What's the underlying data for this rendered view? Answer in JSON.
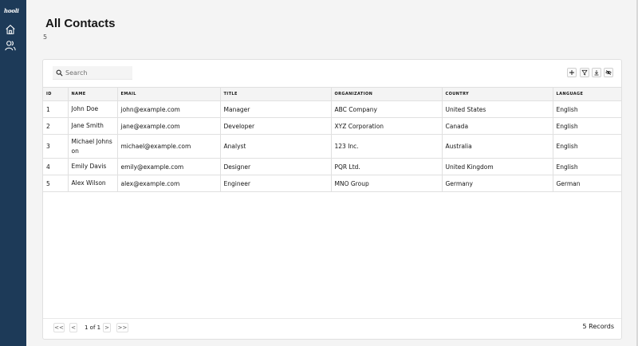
{
  "brand": {
    "logo_text": "hooli",
    "sidebar_color": "#1d3a58"
  },
  "sidebar": {
    "items": [
      {
        "icon": "home-icon"
      },
      {
        "icon": "users-icon"
      }
    ]
  },
  "page": {
    "title": "All Contacts",
    "count": "5"
  },
  "search": {
    "placeholder": "Search",
    "value": ""
  },
  "toolbar": {
    "icons": [
      "add-icon",
      "filter-icon",
      "download-icon",
      "hide-columns-icon"
    ]
  },
  "table": {
    "columns": [
      "ID",
      "NAME",
      "EMAIL",
      "TITLE",
      "ORGANIZATION",
      "COUNTRY",
      "LANGUAGE"
    ],
    "rows": [
      {
        "id": "1",
        "name": "John Doe",
        "email": "john@example.com",
        "title": "Manager",
        "organization": "ABC Company",
        "country": "United States",
        "language": "English"
      },
      {
        "id": "2",
        "name": "Jane Smith",
        "email": "jane@example.com",
        "title": "Developer",
        "organization": "XYZ Corporation",
        "country": "Canada",
        "language": "English"
      },
      {
        "id": "3",
        "name": "Michael Johnson",
        "email": "michael@example.com",
        "title": "Analyst",
        "organization": "123 Inc.",
        "country": "Australia",
        "language": "English"
      },
      {
        "id": "4",
        "name": "Emily Davis",
        "email": "emily@example.com",
        "title": "Designer",
        "organization": "PQR Ltd.",
        "country": "United Kingdom",
        "language": "English"
      },
      {
        "id": "5",
        "name": "Alex Wilson",
        "email": "alex@example.com",
        "title": "Engineer",
        "organization": "MNO Group",
        "country": "Germany",
        "language": "German"
      }
    ]
  },
  "pagination": {
    "first_label": "<<",
    "prev_label": "<",
    "page_info": "1 of 1",
    "next_label": ">",
    "last_label": ">>",
    "records_label": "5 Records"
  }
}
